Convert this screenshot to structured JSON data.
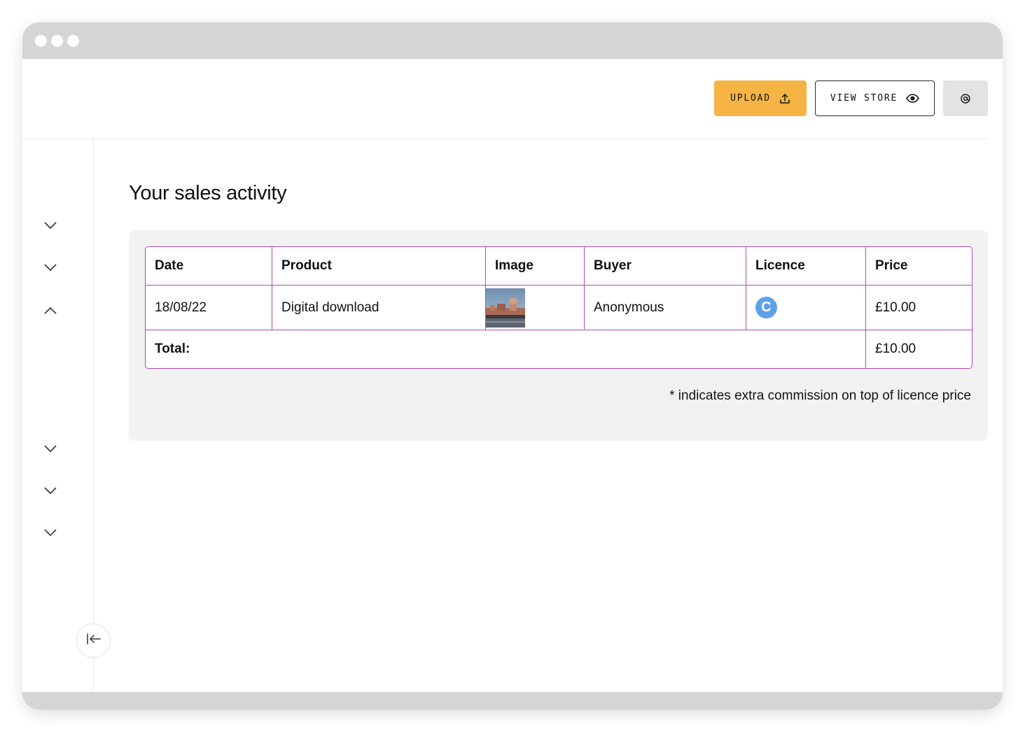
{
  "header": {
    "upload_label": "UPLOAD",
    "view_store_label": "VIEW STORE",
    "upload_icon": "upload-icon",
    "view_icon": "eye-icon",
    "account_icon": "at-sign-icon",
    "accent_color": "#f6b444"
  },
  "sidebar": {
    "items": [
      {
        "icon": "chevron-down-icon",
        "state": "collapsed"
      },
      {
        "icon": "chevron-down-icon",
        "state": "collapsed"
      },
      {
        "icon": "chevron-up-icon",
        "state": "expanded"
      },
      {
        "icon": "chevron-down-icon",
        "state": "collapsed"
      },
      {
        "icon": "chevron-down-icon",
        "state": "collapsed"
      },
      {
        "icon": "chevron-down-icon",
        "state": "collapsed"
      }
    ],
    "collapse_icon": "collapse-left-icon"
  },
  "main": {
    "title": "Your sales activity",
    "table": {
      "border_color": "#b648b6",
      "headers": [
        "Date",
        "Product",
        "Image",
        "Buyer",
        "Licence",
        "Price"
      ],
      "rows": [
        {
          "date": "18/08/22",
          "product": "Digital download",
          "image_icon": "product-thumbnail",
          "buyer": "Anonymous",
          "licence": "C",
          "licence_color": "#5ea0e9",
          "price": "£10.00"
        }
      ],
      "total_label": "Total:",
      "total_value": "£10.00"
    },
    "footnote": "* indicates extra commission on top of licence price"
  }
}
